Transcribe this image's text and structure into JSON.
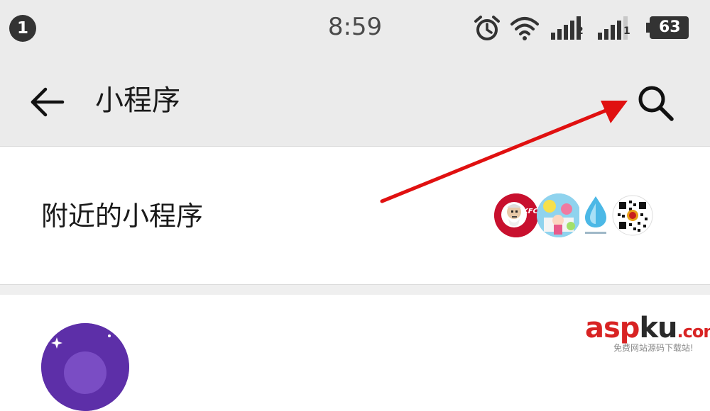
{
  "status_bar": {
    "notification_count": "1",
    "time": "8:59",
    "sim1_label": "2",
    "sim2_label": "1",
    "battery_level": "63",
    "icons": [
      "alarm-icon",
      "wifi-icon",
      "signal-icon",
      "signal-icon",
      "battery-icon"
    ]
  },
  "toolbar": {
    "back_icon": "back-arrow-icon",
    "title": "小程序",
    "search_icon": "search-icon"
  },
  "nearby": {
    "label": "附近的小程序",
    "thumbs": [
      {
        "name": "kfc-logo",
        "text": "KFC"
      },
      {
        "name": "cartoon-logo",
        "text": ""
      },
      {
        "name": "water-drop-logo",
        "text": ""
      },
      {
        "name": "qr-logo",
        "text": ""
      }
    ]
  },
  "watermark": {
    "main_asp": "asp",
    "main_ku": "ku",
    "main_com": ".com",
    "sub": "免费网站源码下载站!"
  },
  "colors": {
    "bar_bg": "#ebebeb",
    "arrow": "#e01010",
    "avatar": "#5d2fa8",
    "watermark_red": "#d82323"
  }
}
